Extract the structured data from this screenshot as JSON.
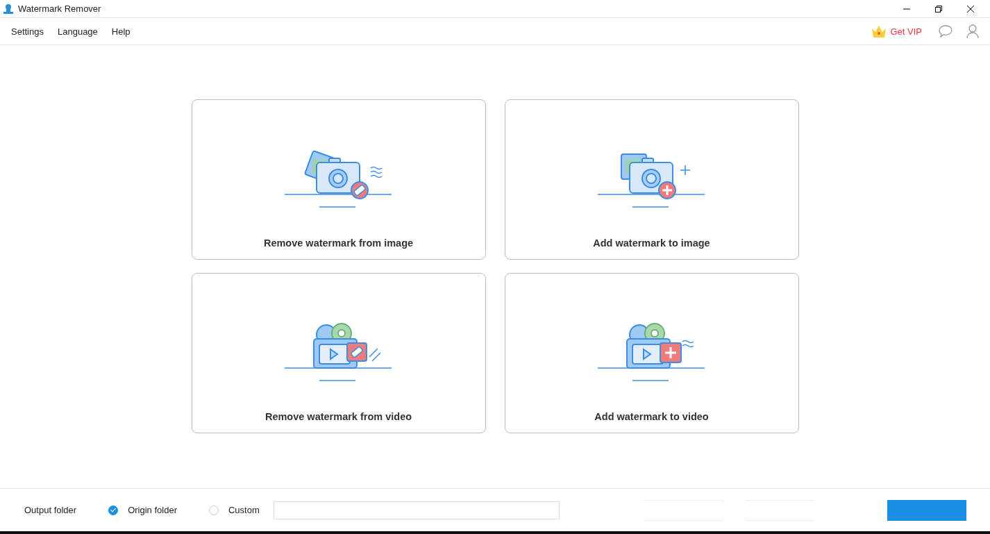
{
  "window": {
    "title": "Watermark Remover"
  },
  "menu": [
    {
      "label": "Settings"
    },
    {
      "label": "Language"
    },
    {
      "label": "Help"
    }
  ],
  "vip": {
    "label": "Get VIP"
  },
  "cards": [
    {
      "label": "Remove watermark from image",
      "kind": "imageremove"
    },
    {
      "label": "Add watermark to image",
      "kind": "imageadd"
    },
    {
      "label": "Remove watermark from video",
      "kind": "videoremove"
    },
    {
      "label": "Add watermark to video",
      "kind": "videoadd"
    }
  ],
  "output": {
    "label": "Output folder",
    "options": [
      {
        "label": "Origin folder",
        "selected": true
      },
      {
        "label": "Custom",
        "selected": false
      }
    ]
  }
}
